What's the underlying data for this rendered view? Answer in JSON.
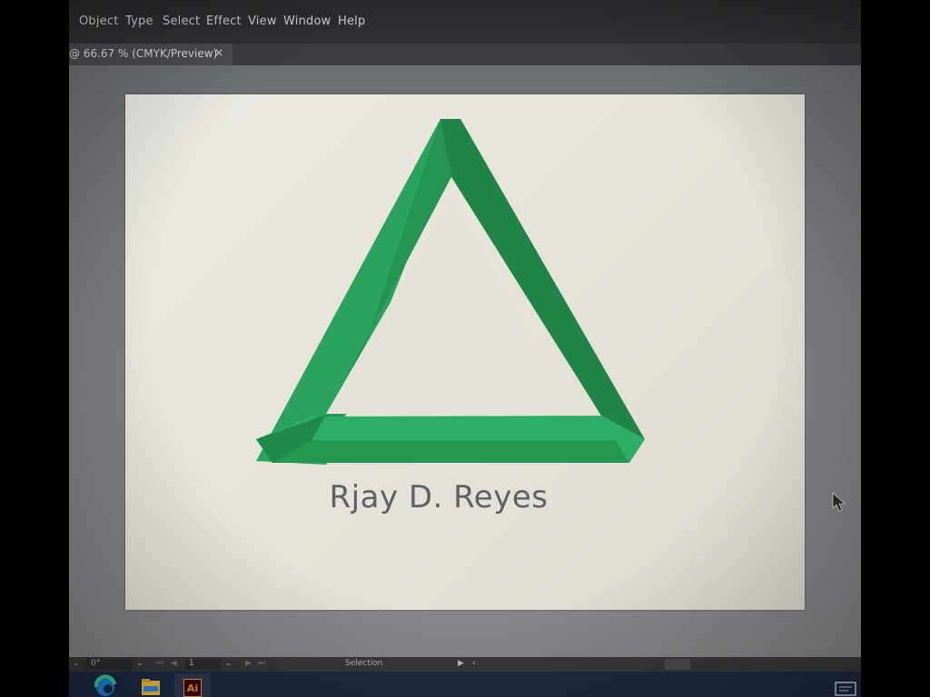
{
  "menubar": {
    "items": [
      "Object",
      "Type",
      "Select",
      "Effect",
      "View",
      "Window",
      "Help"
    ]
  },
  "document_tab": {
    "title": "@ 66.67 % (CMYK/Preview)",
    "close_glyph": "×"
  },
  "artwork": {
    "signature_text": "Rjay D. Reyes",
    "triangle_colors": {
      "light": "#2eaa62",
      "mid": "#23944f",
      "dark": "#1c7a40"
    }
  },
  "statusbar": {
    "rotation": "0°",
    "artboard_number": "1",
    "tool_name": "Selection"
  },
  "taskbar": {
    "apps": [
      "edge-icon",
      "file-explorer-icon",
      "illustrator-icon"
    ],
    "illustrator_label": "Ai"
  },
  "colors": {
    "menubar_bg": "#27292c",
    "pasteboard_bg": "#7a7c80",
    "artboard_bg": "#e6e3da",
    "taskbar_bg": "#1d2b43",
    "illustrator_orange": "#ff9a00"
  }
}
